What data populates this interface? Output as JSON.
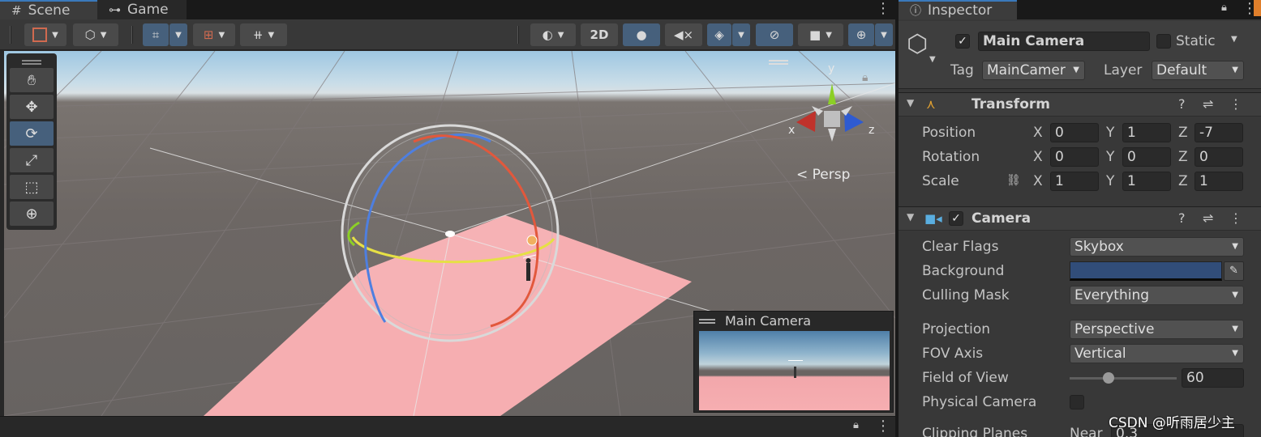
{
  "scene_view": {
    "tabs": [
      {
        "label": "Scene",
        "icon": "hash-icon"
      },
      {
        "label": "Game",
        "icon": "gamepad-icon"
      }
    ],
    "toolbar": {
      "mode_2d_label": "2D",
      "buttons": [
        "draw-mode",
        "shaded-mode",
        "grid-snap",
        "increment-snap",
        "ruler",
        "shading",
        "2d",
        "lighting",
        "audio",
        "effects",
        "hidden-objects",
        "camera",
        "gizmos"
      ]
    },
    "tools": [
      "hand-tool",
      "move-tool",
      "rotate-tool",
      "scale-tool",
      "rect-tool",
      "transform-tool"
    ],
    "active_tool": "rotate-tool",
    "gizmo": {
      "x_label": "x",
      "y_label": "y",
      "z_label": "z",
      "projection_label": "< Persp"
    },
    "camera_preview": {
      "title": "Main Camera"
    }
  },
  "inspector": {
    "tab_label": "Inspector",
    "object": {
      "active": true,
      "name": "Main Camera",
      "static_label": "Static",
      "static": false,
      "tag_label": "Tag",
      "tag_value": "MainCamer",
      "layer_label": "Layer",
      "layer_value": "Default"
    },
    "transform": {
      "title": "Transform",
      "axis_labels": {
        "x": "X",
        "y": "Y",
        "z": "Z"
      },
      "position_label": "Position",
      "position": {
        "x": "0",
        "y": "1",
        "z": "-7"
      },
      "rotation_label": "Rotation",
      "rotation": {
        "x": "0",
        "y": "0",
        "z": "0"
      },
      "scale_label": "Scale",
      "scale": {
        "x": "1",
        "y": "1",
        "z": "1"
      }
    },
    "camera": {
      "title": "Camera",
      "enabled": true,
      "clear_flags_label": "Clear Flags",
      "clear_flags_value": "Skybox",
      "background_label": "Background",
      "background_color": "#314D79",
      "culling_mask_label": "Culling Mask",
      "culling_mask_value": "Everything",
      "projection_label": "Projection",
      "projection_value": "Perspective",
      "fov_axis_label": "FOV Axis",
      "fov_axis_value": "Vertical",
      "fov_label": "Field of View",
      "fov_value": "60",
      "fov_slider_fraction": 0.36,
      "physical_camera_label": "Physical Camera",
      "physical_camera": false,
      "clipping_planes_label": "Clipping Planes",
      "near_label": "Near",
      "near_value": "0.3"
    }
  },
  "watermark": "CSDN @听雨居少主",
  "colors": {
    "accent": "#3a79bb",
    "active_button": "#46607c",
    "plane": "#f6aeb1",
    "x_axis": "#c0322b",
    "y_axis": "#8ccf26",
    "z_axis": "#2f5bd0"
  }
}
